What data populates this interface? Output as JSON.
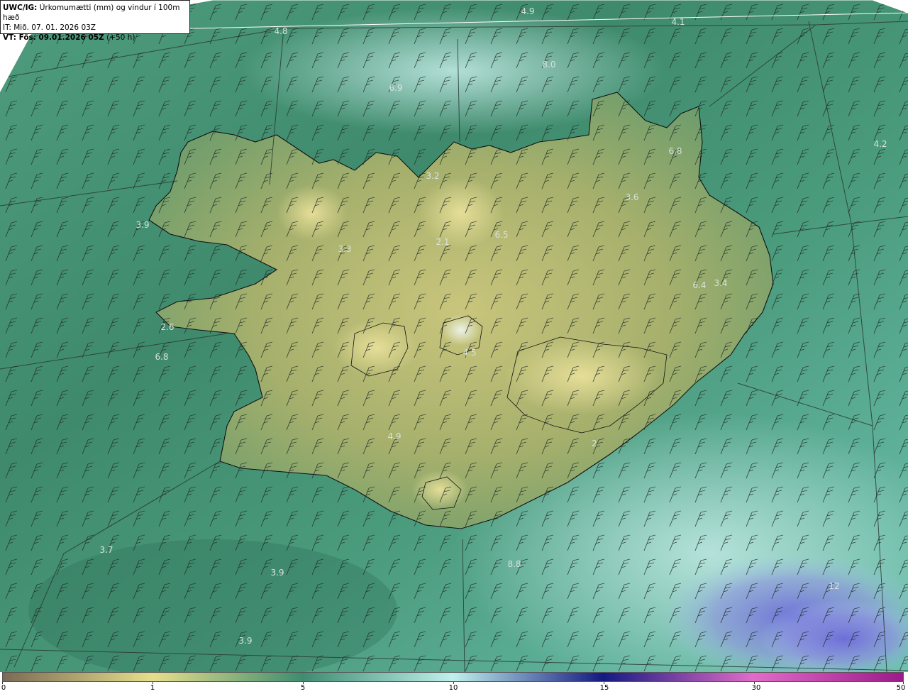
{
  "header": {
    "model": "UWC/IG:",
    "product": " Úrkomumætti (mm) og vindur í 100m hæð",
    "initial_time": "IT: Mið. 07. 01. 2026 03Z",
    "valid_prefix": "VT: Fös. 09.01.2026 05Z",
    "valid_suffix": " (+50 h)"
  },
  "colorbar": {
    "ticks": [
      {
        "value": "0"
      },
      {
        "value": "1"
      },
      {
        "value": "5"
      },
      {
        "value": "10"
      },
      {
        "value": "15"
      },
      {
        "value": "30"
      },
      {
        "value": "50"
      }
    ],
    "colors": {
      "0": "#7a6a55",
      "1": "#e6df8c",
      "5": "#3f8c70",
      "10": "#bff0ec",
      "15": "#141a80",
      "30": "#e06cc8",
      "50": "#9c1a8a"
    }
  },
  "map": {
    "value_labels": [
      "4.9",
      "4.1",
      "4.8",
      "8.0",
      "6.9",
      "6.8",
      "4.2",
      "3.2",
      "3.6",
      "3.9",
      "3.3",
      "2.1",
      "6.5",
      "6.4",
      "3.4",
      "2.6",
      "6.8",
      "4.5",
      "4.9",
      "3.7",
      "3.9",
      "8.8",
      "3.9",
      "12",
      "2"
    ]
  }
}
